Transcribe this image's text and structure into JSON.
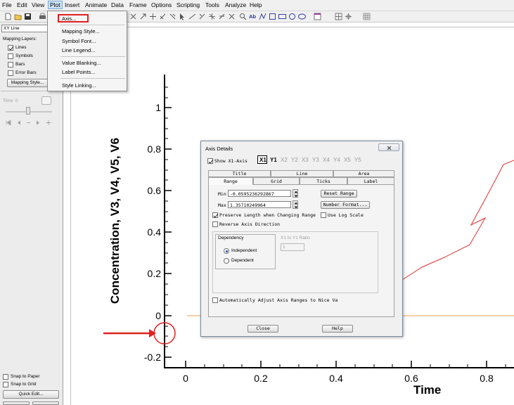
{
  "menubar": [
    "File",
    "Edit",
    "View",
    "Plot",
    "Insert",
    "Animate",
    "Data",
    "Frame",
    "Options",
    "Scripting",
    "Tools",
    "Analyze",
    "Help"
  ],
  "plot_menu": {
    "items": [
      "Axis...",
      "Mapping Style...",
      "Symbol Font...",
      "Line Legend...",
      "Value Blanking...",
      "Label Points...",
      "Style Linking..."
    ]
  },
  "toolbar": {
    "text_tool_label": "Ab"
  },
  "left_panel": {
    "plot_type": "XY Line",
    "mapping_layers_label": "Mapping Layers:",
    "layers": [
      {
        "label": "Lines",
        "checked": true
      },
      {
        "label": "Symbols",
        "checked": false
      },
      {
        "label": "Bars",
        "checked": false
      },
      {
        "label": "Error Bars",
        "checked": false
      }
    ],
    "mapping_style_button": "Mapping Style...",
    "time_label": "Time",
    "time_value": "0",
    "snap_to_paper": "Snap to Paper",
    "snap_to_grid": "Snap to Grid",
    "quick_edit_button": "Quick Edit..."
  },
  "plot": {
    "ylabel": "Concentration, V3, V4, V5, V6",
    "xlabel": "Time",
    "y_ticks": [
      "1",
      "0.8",
      "0.6",
      "0.4",
      "0.2",
      "0",
      "-0.2"
    ],
    "x_ticks": [
      "0",
      "0.2",
      "0.4",
      "0.6",
      "0.8"
    ]
  },
  "dialog": {
    "title": "Axis Details",
    "show_axis_label": "Show X1-Axis",
    "show_axis_checked": true,
    "axes": [
      "X1",
      "Y1",
      "X2",
      "Y2",
      "X3",
      "Y3",
      "X4",
      "Y4",
      "X5",
      "Y5"
    ],
    "tabs_row1": [
      "Title",
      "Line",
      "Area"
    ],
    "tabs_row2": [
      "Range",
      "Grid",
      "Ticks",
      "Label"
    ],
    "min_label": "Min",
    "min_value": "-0.0595236292867",
    "max_label": "Max",
    "max_value": "1.35710249964",
    "reset_range": "Reset Range",
    "number_format": "Number Format...",
    "preserve_length": "Preserve Length when Changing Range",
    "use_log_scale": "Use Log Scale",
    "reverse_direction": "Reverse Axis Direction",
    "dependency_label": "Dependency",
    "ratio_label": "X1 to Y1 Ratio",
    "ratio_value": "1",
    "independent": "Independent",
    "dependent": "Dependent",
    "auto_adjust": "Automatically Adjust Axis Ranges to Nice Va",
    "close_button": "Close",
    "help_button": "Help"
  },
  "colors": {
    "accent_red": "#e02020",
    "curve_red": "#e03030",
    "curve_orange": "#f0a050"
  }
}
